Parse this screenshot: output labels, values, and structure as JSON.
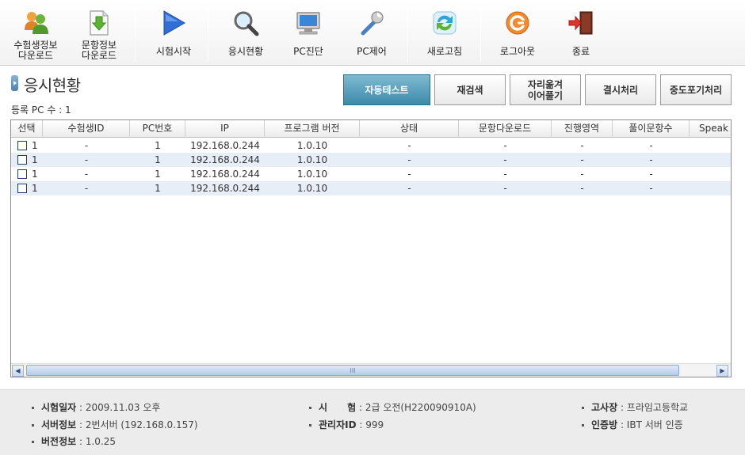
{
  "toolbar": {
    "buttons": [
      {
        "label": "수험생정보\n다운로드",
        "icon": "users-icon"
      },
      {
        "label": "문항정보\n다운로드",
        "icon": "download-doc-icon"
      },
      {
        "label": "시험시작",
        "icon": "play-icon"
      },
      {
        "label": "응시현황",
        "icon": "magnifier-icon"
      },
      {
        "label": "PC진단",
        "icon": "monitor-icon"
      },
      {
        "label": "PC제어",
        "icon": "wrench-icon"
      },
      {
        "label": "새로고침",
        "icon": "refresh-icon"
      },
      {
        "label": "로그아웃",
        "icon": "logout-icon"
      },
      {
        "label": "종료",
        "icon": "exit-door-icon"
      }
    ]
  },
  "page": {
    "title": "응시현황",
    "count_label": "등록 PC 수 : 1"
  },
  "actions": {
    "auto_test": "자동테스트",
    "research": "재검색",
    "seat_move": "자리옮겨\n이어풀기",
    "absence": "결시처리",
    "give_up": "중도포기처리"
  },
  "grid": {
    "columns": [
      "선택",
      "수험생ID",
      "PC번호",
      "IP",
      "프로그램 버전",
      "상태",
      "문항다운로드",
      "진행영역",
      "풀이문항수",
      "Speak"
    ],
    "rows": [
      [
        "1",
        "-",
        "1",
        "192.168.0.244",
        "1.0.10",
        "-",
        "-",
        "-",
        "-"
      ],
      [
        "1",
        "-",
        "1",
        "192.168.0.244",
        "1.0.10",
        "-",
        "-",
        "-",
        "-"
      ],
      [
        "1",
        "-",
        "1",
        "192.168.0.244",
        "1.0.10",
        "-",
        "-",
        "-",
        "-"
      ],
      [
        "1",
        "-",
        "1",
        "192.168.0.244",
        "1.0.10",
        "-",
        "-",
        "-",
        "-"
      ]
    ],
    "scroll_grip": "III"
  },
  "footer": {
    "exam_date_key": "시험일자",
    "exam_date_value": ":  2009.11.03 오후",
    "server_key": "서버정보",
    "server_value": ":  2번서버 (192.168.0.157)",
    "version_key": "버전정보",
    "version_value": ":  1.0.25",
    "exam_key": "시      험",
    "exam_value": ":  2급 오전(H220090910A)",
    "admin_key": "관리자ID",
    "admin_value": ":  999",
    "site_key": "고사장",
    "site_value": ":  프라임고등학교",
    "auth_key": "인증방",
    "auth_value": ":  IBT 서버 인증"
  },
  "colors": {
    "primary_button": "#3c8aaa",
    "row_alt": "#e8eef7",
    "footer_bg": "#ececec"
  }
}
